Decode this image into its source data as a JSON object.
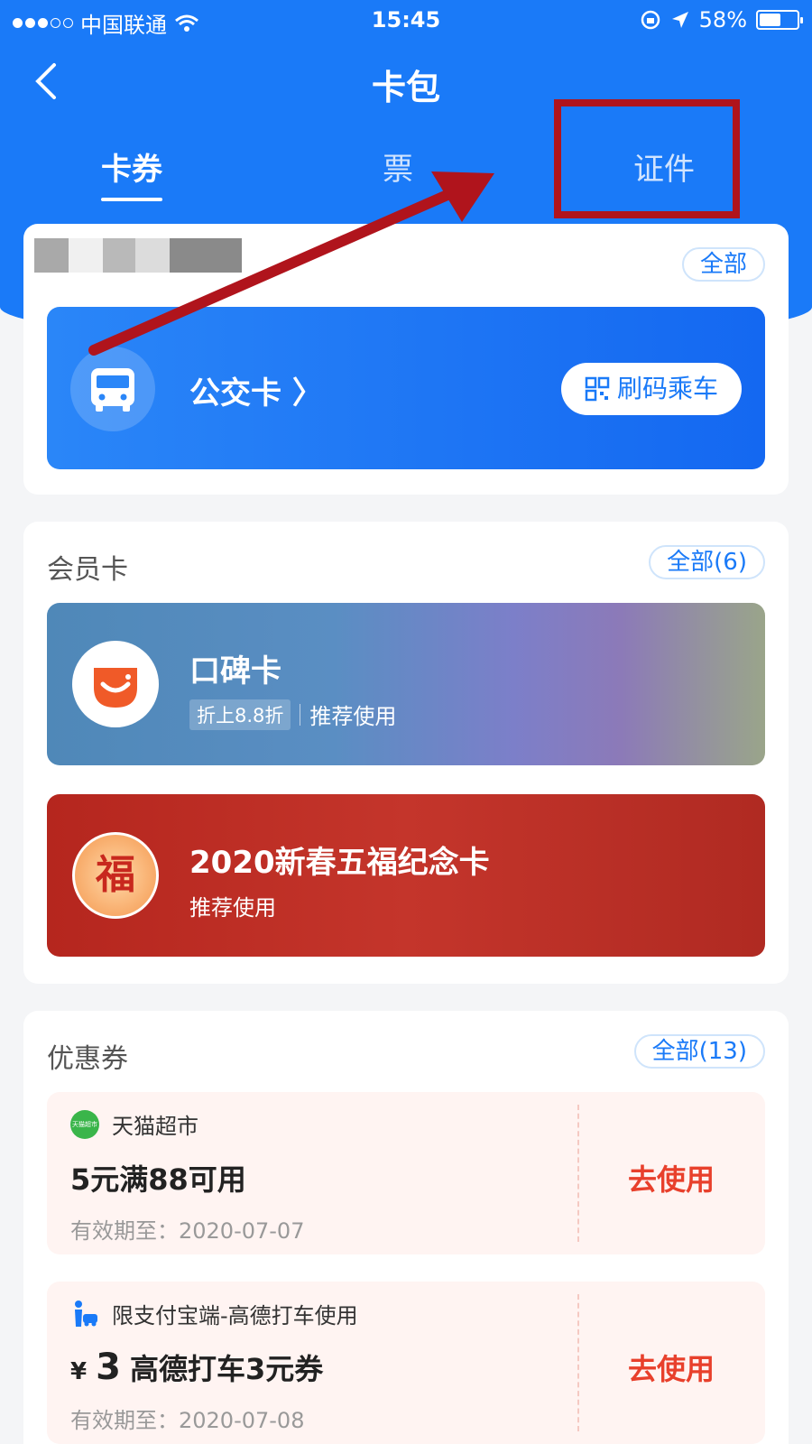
{
  "status_bar": {
    "carrier": "中国联通",
    "time": "15:45",
    "battery": "58%",
    "battery_level": 0.58
  },
  "header": {
    "title": "卡包"
  },
  "tabs": [
    {
      "label": "卡券",
      "active": true
    },
    {
      "label": "票",
      "active": false
    },
    {
      "label": "证件",
      "active": false
    }
  ],
  "transit_section": {
    "all_label": "全部",
    "card_label": "公交卡 〉",
    "scan_button": "刷码乘车"
  },
  "member_section": {
    "title": "会员卡",
    "all_label": "全部(6)",
    "cards": [
      {
        "name": "口碑卡",
        "tag": "折上8.8折",
        "note": "推荐使用"
      },
      {
        "name": "2020新春五福纪念卡",
        "note": "推荐使用",
        "logo_char": "福"
      }
    ]
  },
  "coupon_section": {
    "title": "优惠券",
    "all_label": "全部(13)",
    "coupons": [
      {
        "brand": "天猫超市",
        "brand_logo_text": "天猫超市",
        "title": "5元满88可用",
        "valid": "有效期至：2020-07-07",
        "action": "去使用"
      },
      {
        "brand": "限支付宝端-高德打车使用",
        "currency": "¥",
        "amount": "3",
        "title": "高德打车3元券",
        "valid": "有效期至：2020-07-08",
        "action": "去使用"
      }
    ]
  },
  "colors": {
    "primary": "#1a7af8",
    "coupon_action": "#e8402c",
    "annotation": "#b0141c"
  }
}
